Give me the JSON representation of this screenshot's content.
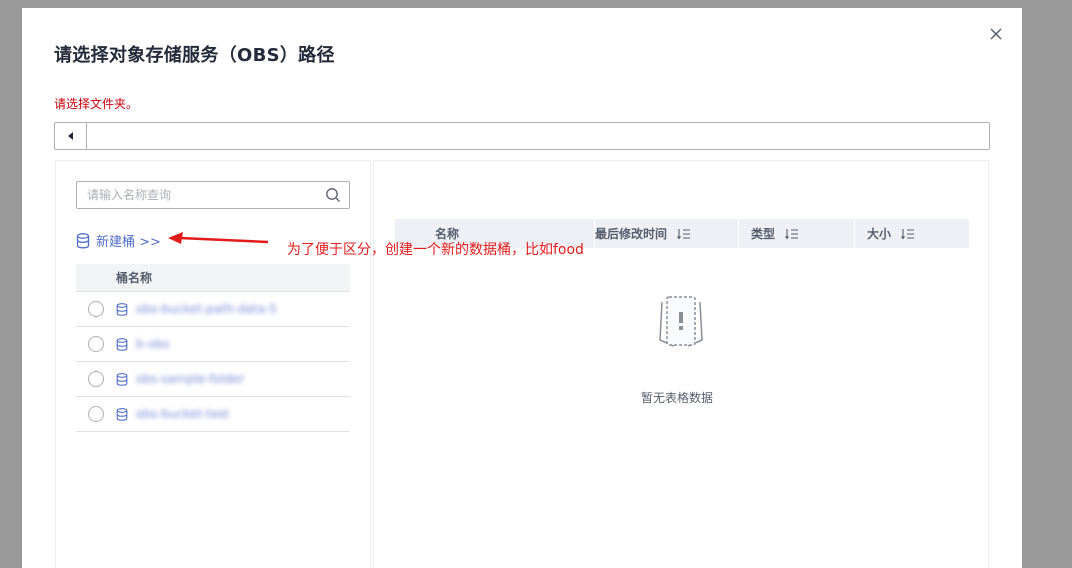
{
  "dialog": {
    "title": "请选择对象存储服务（OBS）路径",
    "hint": "请选择文件夹。",
    "path_value": ""
  },
  "left": {
    "search_placeholder": "请输入名称查询",
    "new_bucket_label": "新建桶 >>",
    "header": "桶名称",
    "buckets": [
      {
        "name": "obs-bucket-path-data-5"
      },
      {
        "name": "b-obs"
      },
      {
        "name": "obs-sample-folder"
      },
      {
        "name": "obs-bucket-test"
      }
    ]
  },
  "right": {
    "columns": [
      "名称",
      "最后修改时间",
      "类型",
      "大小"
    ],
    "empty_text": "暂无表格数据"
  },
  "annotation": {
    "text": "为了便于区分，创建一个新的数据桶，比如food",
    "color": "#e31b1b"
  },
  "colors": {
    "link": "#526ecc",
    "error": "#c7000b",
    "header_bg": "#eef0f5"
  }
}
